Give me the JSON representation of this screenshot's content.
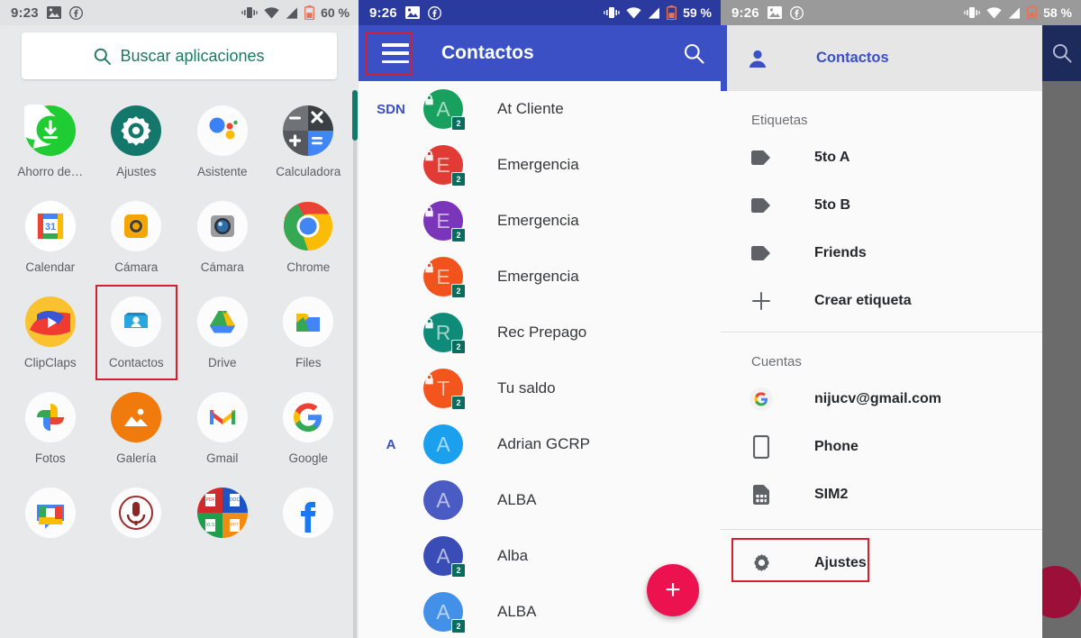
{
  "panel1": {
    "status": {
      "time": "9:23",
      "battery": "60 %",
      "icons": [
        "image-icon",
        "facebook-icon",
        "vibrate-icon",
        "wifi-icon",
        "signal-icon",
        "battery-low-icon"
      ]
    },
    "search": {
      "placeholder": "Buscar aplicaciones",
      "icon": "search-icon",
      "accent": "#1d7a62"
    },
    "apps": [
      {
        "label": "Ahorro de…",
        "icon": "whatsapp-save-icon"
      },
      {
        "label": "Ajustes",
        "icon": "settings-gear-icon"
      },
      {
        "label": "Asistente",
        "icon": "google-assistant-icon"
      },
      {
        "label": "Calculadora",
        "icon": "calculator-icon"
      },
      {
        "label": "Calendar",
        "icon": "google-calendar-icon"
      },
      {
        "label": "Cámara",
        "icon": "camera-orange-icon"
      },
      {
        "label": "Cámara",
        "icon": "camera-lens-icon"
      },
      {
        "label": "Chrome",
        "icon": "chrome-icon"
      },
      {
        "label": "ClipClaps",
        "icon": "clipclaps-icon"
      },
      {
        "label": "Contactos",
        "icon": "contacts-icon",
        "highlighted": true
      },
      {
        "label": "Drive",
        "icon": "google-drive-icon"
      },
      {
        "label": "Files",
        "icon": "files-icon"
      },
      {
        "label": "Fotos",
        "icon": "google-photos-icon"
      },
      {
        "label": "Galería",
        "icon": "gallery-icon"
      },
      {
        "label": "Gmail",
        "icon": "gmail-icon"
      },
      {
        "label": "Google",
        "icon": "google-icon"
      },
      {
        "label": "",
        "icon": "google-chat-icon"
      },
      {
        "label": "",
        "icon": "recorder-icon"
      },
      {
        "label": "",
        "icon": "office-docs-icon"
      },
      {
        "label": "",
        "icon": "facebook-icon"
      }
    ],
    "highlight_color": "#d32030"
  },
  "panel2": {
    "status": {
      "time": "9:26",
      "battery": "59 %"
    },
    "appbar": {
      "title": "Contactos",
      "menu_icon": "hamburger-menu-icon",
      "search_icon": "search-icon",
      "bg": "#3b50c4",
      "menu_highlighted": true
    },
    "sections": [
      "SDN",
      "A"
    ],
    "contacts": [
      {
        "name": "At Cliente",
        "initial": "A",
        "color": "#17a05e",
        "section": "SDN",
        "sim": "2",
        "locked": true
      },
      {
        "name": "Emergencia",
        "initial": "E",
        "color": "#e23b36",
        "section": "",
        "sim": "2",
        "locked": true
      },
      {
        "name": "Emergencia",
        "initial": "E",
        "color": "#7b35b8",
        "section": "",
        "sim": "2",
        "locked": true
      },
      {
        "name": "Emergencia",
        "initial": "E",
        "color": "#f2531c",
        "section": "",
        "sim": "2",
        "locked": true
      },
      {
        "name": "Rec Prepago",
        "initial": "R",
        "color": "#0e8b79",
        "section": "",
        "sim": "2",
        "locked": true
      },
      {
        "name": "Tu saldo",
        "initial": "T",
        "color": "#f4551d",
        "section": "",
        "sim": "2",
        "locked": true
      },
      {
        "name": "Adrian GCRP",
        "initial": "A",
        "color": "#1aa0ec",
        "section": "A",
        "sim": "",
        "locked": false
      },
      {
        "name": "ALBA",
        "initial": "A",
        "color": "#4a5bc4",
        "section": "",
        "sim": "",
        "locked": false
      },
      {
        "name": "Alba",
        "initial": "A",
        "color": "#3a4cb5",
        "section": "",
        "sim": "2",
        "locked": false
      },
      {
        "name": "ALBA",
        "initial": "A",
        "color": "#4390e8",
        "section": "",
        "sim": "2",
        "locked": false
      }
    ],
    "fab": {
      "icon": "plus-icon",
      "color": "#ec1250"
    }
  },
  "panel3": {
    "status": {
      "time": "9:26",
      "battery": "58 %"
    },
    "drawer": {
      "header": {
        "title": "Contactos",
        "avatar_icon": "person-avatar-icon"
      },
      "labels_section": "Etiquetas",
      "labels": [
        {
          "text": "5to A",
          "icon": "label-tag-icon"
        },
        {
          "text": "5to B",
          "icon": "label-tag-icon"
        },
        {
          "text": "Friends",
          "icon": "label-tag-icon"
        },
        {
          "text": "Crear etiqueta",
          "icon": "plus-icon"
        }
      ],
      "accounts_section": "Cuentas",
      "accounts": [
        {
          "text": "nijucv@gmail.com",
          "icon": "google-g-icon"
        },
        {
          "text": "Phone",
          "icon": "phone-device-icon"
        },
        {
          "text": "SIM2",
          "icon": "sim-card-icon"
        }
      ],
      "settings": {
        "text": "Ajustes",
        "icon": "gear-icon",
        "highlighted": true
      }
    },
    "search_icon": "search-icon",
    "highlight_color": "#d32030"
  }
}
